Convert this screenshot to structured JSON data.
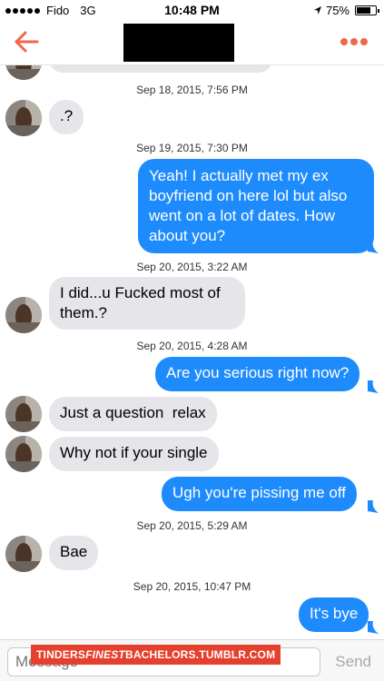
{
  "status_bar": {
    "carrier": "Fido",
    "network": "3G",
    "time": "10:48 PM",
    "battery": "75%"
  },
  "header": {
    "back_icon": "back-arrow-icon",
    "menu_icon": "more-dots-icon",
    "accent_color": "#f2664a"
  },
  "messages": [
    {
      "type": "timestamp",
      "text": "Sep 18, 2015, 7:56 PM"
    },
    {
      "type": "in",
      "text": ".?"
    },
    {
      "type": "timestamp",
      "text": "Sep 19, 2015, 7:30 PM"
    },
    {
      "type": "out",
      "text": "Yeah! I actually met my ex boyfriend on here lol but also went on a lot of dates. How about you?"
    },
    {
      "type": "timestamp",
      "text": "Sep 20, 2015, 3:22 AM"
    },
    {
      "type": "in",
      "text": "I did...u Fucked most of them.?"
    },
    {
      "type": "timestamp",
      "text": "Sep 20, 2015, 4:28 AM"
    },
    {
      "type": "out",
      "text": "Are you serious right now?"
    },
    {
      "type": "in",
      "text": "Just a question  relax"
    },
    {
      "type": "in",
      "text": "Why not if your single"
    },
    {
      "type": "out",
      "text": "Ugh you're pissing me off"
    },
    {
      "type": "timestamp",
      "text": "Sep 20, 2015, 5:29 AM"
    },
    {
      "type": "in",
      "text": "Bae"
    },
    {
      "type": "timestamp",
      "text": "Sep 20, 2015, 10:47 PM"
    },
    {
      "type": "out",
      "text": "It's bye"
    }
  ],
  "input": {
    "placeholder": "Message",
    "send_label": "Send"
  },
  "watermark": {
    "part1": "TINDERS",
    "part2": "FINEST",
    "part3": "BACHELORS.TUMBLR.COM"
  },
  "colors": {
    "outgoing_bubble": "#1e8bfd",
    "incoming_bubble": "#e5e5ea"
  }
}
